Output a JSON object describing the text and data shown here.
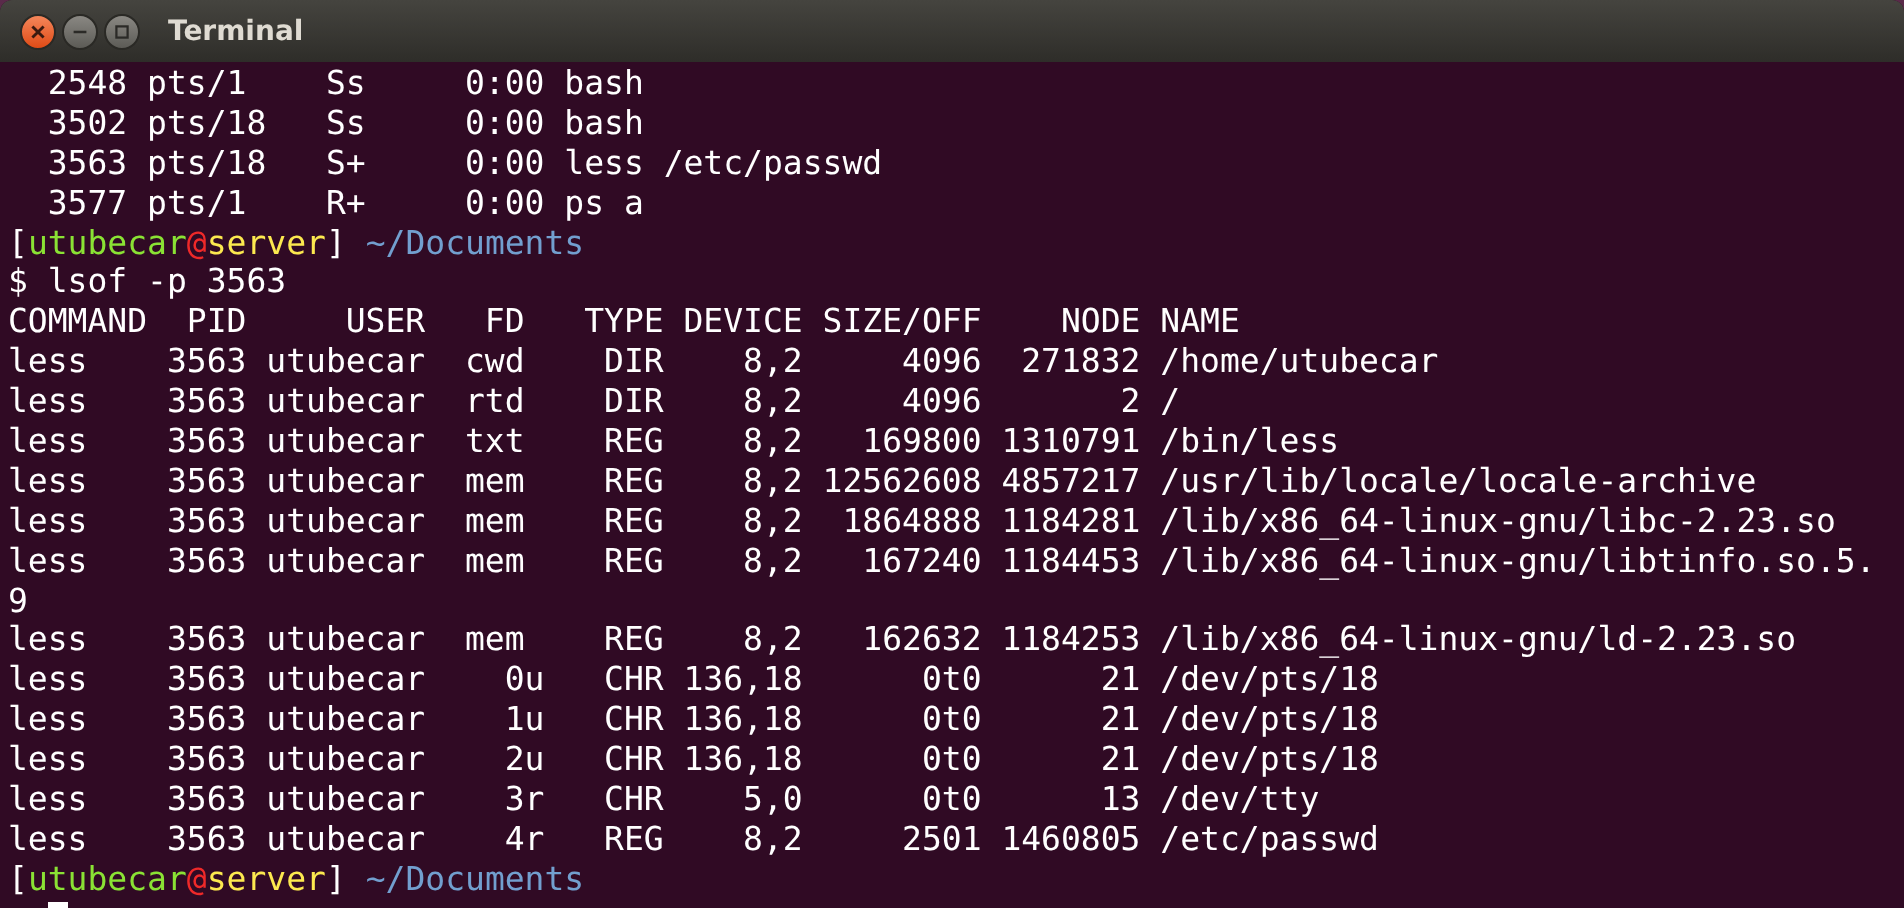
{
  "window": {
    "title": "Terminal"
  },
  "lines": [
    {
      "kind": "text",
      "text": "  2548 pts/1    Ss     0:00 bash"
    },
    {
      "kind": "text",
      "text": "  3502 pts/18   Ss     0:00 bash"
    },
    {
      "kind": "text",
      "text": "  3563 pts/18   S+     0:00 less /etc/passwd"
    },
    {
      "kind": "text",
      "text": "  3577 pts/1    R+     0:00 ps a"
    },
    {
      "kind": "prompt",
      "segments": [
        {
          "text": "[",
          "color": "#ffffff"
        },
        {
          "text": "utubecar",
          "color": "#8ae234"
        },
        {
          "text": "@",
          "color": "#ef2929"
        },
        {
          "text": "server",
          "color": "#fce94f"
        },
        {
          "text": "]",
          "color": "#ffffff"
        },
        {
          "text": " ~/Documents",
          "color": "#729fcf"
        }
      ]
    },
    {
      "kind": "text",
      "text": "$ lsof -p 3563"
    },
    {
      "kind": "text",
      "text": "COMMAND  PID     USER   FD   TYPE DEVICE SIZE/OFF    NODE NAME"
    },
    {
      "kind": "text",
      "text": "less    3563 utubecar  cwd    DIR    8,2     4096  271832 /home/utubecar"
    },
    {
      "kind": "text",
      "text": "less    3563 utubecar  rtd    DIR    8,2     4096       2 /"
    },
    {
      "kind": "text",
      "text": "less    3563 utubecar  txt    REG    8,2   169800 1310791 /bin/less"
    },
    {
      "kind": "text",
      "text": "less    3563 utubecar  mem    REG    8,2 12562608 4857217 /usr/lib/locale/locale-archive"
    },
    {
      "kind": "text",
      "text": "less    3563 utubecar  mem    REG    8,2  1864888 1184281 /lib/x86_64-linux-gnu/libc-2.23.so"
    },
    {
      "kind": "text",
      "text": "less    3563 utubecar  mem    REG    8,2   167240 1184453 /lib/x86_64-linux-gnu/libtinfo.so.5."
    },
    {
      "kind": "text",
      "text": "9"
    },
    {
      "kind": "text",
      "text": "less    3563 utubecar  mem    REG    8,2   162632 1184253 /lib/x86_64-linux-gnu/ld-2.23.so"
    },
    {
      "kind": "text",
      "text": "less    3563 utubecar    0u   CHR 136,18      0t0      21 /dev/pts/18"
    },
    {
      "kind": "text",
      "text": "less    3563 utubecar    1u   CHR 136,18      0t0      21 /dev/pts/18"
    },
    {
      "kind": "text",
      "text": "less    3563 utubecar    2u   CHR 136,18      0t0      21 /dev/pts/18"
    },
    {
      "kind": "text",
      "text": "less    3563 utubecar    3r   CHR    5,0      0t0      13 /dev/tty"
    },
    {
      "kind": "text",
      "text": "less    3563 utubecar    4r   REG    8,2     2501 1460805 /etc/passwd"
    },
    {
      "kind": "prompt",
      "segments": [
        {
          "text": "[",
          "color": "#ffffff"
        },
        {
          "text": "utubecar",
          "color": "#8ae234"
        },
        {
          "text": "@",
          "color": "#ef2929"
        },
        {
          "text": "server",
          "color": "#fce94f"
        },
        {
          "text": "]",
          "color": "#ffffff"
        },
        {
          "text": " ~/Documents",
          "color": "#729fcf"
        }
      ]
    },
    {
      "kind": "cursor"
    }
  ]
}
